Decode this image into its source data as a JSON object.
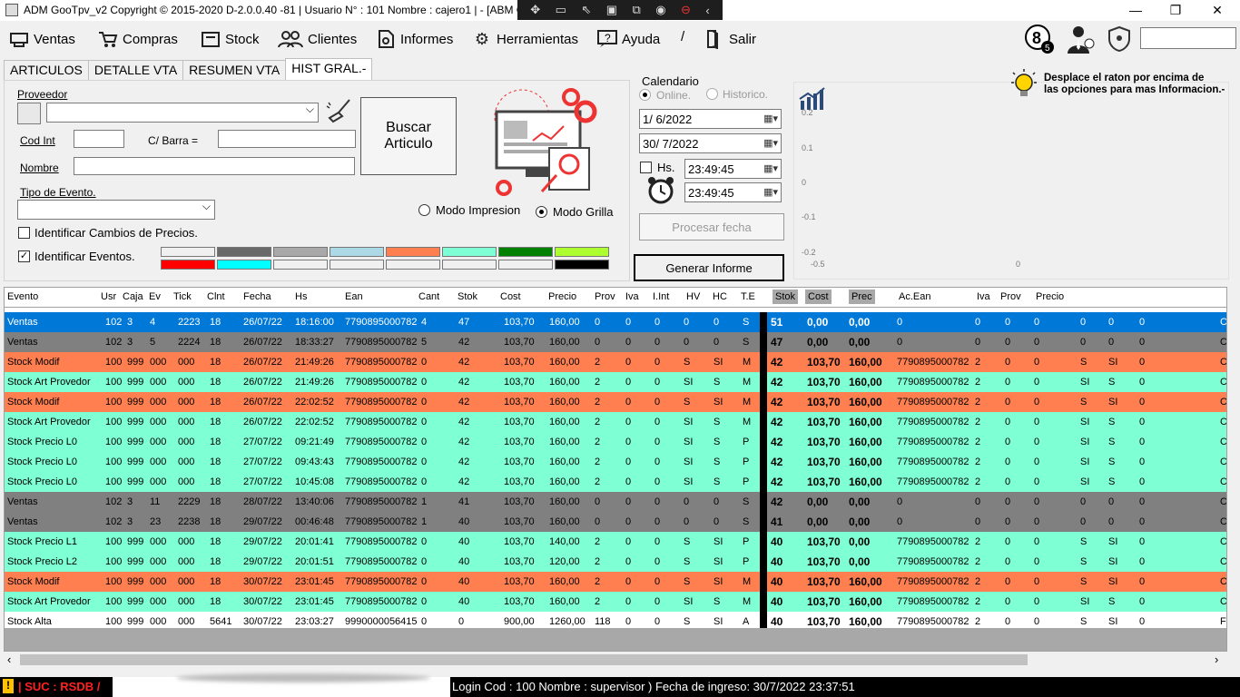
{
  "window": {
    "title": "ADM GooTpv_v2 Copyright ©  2015-2020 D-2.0.0.40 -81 | Usuario N° : 101 Nombre : cajero1 | - [ABM Ger",
    "minimize": "—",
    "restore": "❐",
    "close": "✕"
  },
  "menu": {
    "items": [
      {
        "label": "Ventas",
        "icon": "cart-register-icon"
      },
      {
        "label": "Compras",
        "icon": "shopping-cart-icon"
      },
      {
        "label": "Stock",
        "icon": "box-icon"
      },
      {
        "label": "Clientes",
        "icon": "users-icon"
      },
      {
        "label": "Informes",
        "icon": "report-icon"
      },
      {
        "label": "Herramientas",
        "icon": "gear-icon"
      },
      {
        "label": "Ayuda",
        "icon": "help-icon"
      },
      {
        "label": "/",
        "icon": ""
      },
      {
        "label": "Salir",
        "icon": "exit-icon"
      }
    ],
    "badge_count": "8",
    "badge_sub": "5"
  },
  "tabs": [
    "ARTICULOS",
    "DETALLE VTA",
    "RESUMEN VTA",
    "HIST GRAL.-"
  ],
  "form": {
    "proveedor_label": "Proveedor",
    "codint_label": "Cod Int",
    "cbarra_label": "C/ Barra =",
    "nombre_label": "Nombre",
    "tipo_evento_label": "Tipo de Evento.",
    "identificar_cambios_label": "Identificar Cambios de Precios.",
    "identificar_eventos_label": "Identificar Eventos.",
    "buscar_label_1": "Buscar",
    "buscar_label_2": "Articulo",
    "modo_impresion": "Modo Impresion",
    "modo_grilla": "Modo Grilla",
    "swatch_colors_top": [
      "#f0f0f0",
      "#696969",
      "#a9a9a9",
      "#add8e6",
      "#ff7f50",
      "#7fffd4",
      "#008000",
      "#adff2f"
    ],
    "swatch_colors_bottom": [
      "#ff0000",
      "#00ffff",
      "#f0f0f0",
      "#f0f0f0",
      "#f0f0f0",
      "#f0f0f0",
      "#f0f0f0",
      "#000000"
    ]
  },
  "calendar": {
    "title": "Calendario",
    "online": "Online.",
    "historico": "Historico.",
    "date_from": "1/  6/2022",
    "date_to": "30/  7/2022",
    "hs_label": "Hs.",
    "time_from": "23:49:45",
    "time_to": "23:49:45",
    "procesar_label": "Procesar fecha",
    "generar_label": "Generar Informe"
  },
  "chart_data": {
    "type": "line",
    "y_ticks": [
      "0.2",
      "0.1",
      "0",
      "-0.1",
      "-0.2"
    ],
    "x_ticks": [
      "-0.5",
      "0"
    ],
    "ylim": [
      -0.2,
      0.2
    ],
    "series": []
  },
  "tip": {
    "line1": "Desplace el raton por encima de",
    "line2": "las opciones para mas Informacion.-"
  },
  "grid": {
    "headers": [
      "Evento",
      "Usr",
      "Caja",
      "Ev",
      "Tick",
      "Clnt",
      "Fecha",
      "Hs",
      "Ean",
      "Cant",
      "Stok",
      "Cost",
      "Precio",
      "Prov",
      "Iva",
      "I.Int",
      "HV",
      "HC",
      "T.E",
      "Stok",
      "Cost",
      "Prec",
      "Ac.Ean",
      "Iva",
      "Prov",
      "Precio"
    ],
    "rows": [
      {
        "c": [
          "Ventas",
          "102",
          "3",
          "4",
          "2223",
          "18",
          "26/07/22",
          "18:16:00",
          "7790895000782",
          "4",
          "47",
          "103,70",
          "160,00",
          "0",
          "0",
          "0",
          "0",
          "0",
          "S",
          "51",
          "0,00",
          "0,00",
          "0",
          "0",
          "0",
          "0",
          "0",
          "0",
          "0",
          "C"
        ],
        "bg": "#0078d7",
        "fg": "#ffffff"
      },
      {
        "c": [
          "Ventas",
          "102",
          "3",
          "5",
          "2224",
          "18",
          "26/07/22",
          "18:33:27",
          "7790895000782",
          "5",
          "42",
          "103,70",
          "160,00",
          "0",
          "0",
          "0",
          "0",
          "0",
          "S",
          "47",
          "0,00",
          "0,00",
          "0",
          "0",
          "0",
          "0",
          "0",
          "0",
          "0",
          "C"
        ],
        "bg": "#808080",
        "fg": "#000000"
      },
      {
        "c": [
          "Stock Modif",
          "100",
          "999",
          "000",
          "000",
          "18",
          "26/07/22",
          "21:49:26",
          "7790895000782",
          "0",
          "42",
          "103,70",
          "160,00",
          "2",
          "0",
          "0",
          "S",
          "SI",
          "M",
          "42",
          "103,70",
          "160,00",
          "7790895000782",
          "2",
          "0",
          "0",
          "S",
          "SI",
          "0",
          "C"
        ],
        "bg": "#ff7f50",
        "fg": "#000000"
      },
      {
        "c": [
          "Stock Art Provedor",
          "100",
          "999",
          "000",
          "000",
          "18",
          "26/07/22",
          "21:49:26",
          "7790895000782",
          "0",
          "42",
          "103,70",
          "160,00",
          "2",
          "0",
          "0",
          "SI",
          "S",
          "M",
          "42",
          "103,70",
          "160,00",
          "7790895000782",
          "2",
          "0",
          "0",
          "SI",
          "S",
          "0",
          "C"
        ],
        "bg": "#7fffd4",
        "fg": "#000000"
      },
      {
        "c": [
          "Stock Modif",
          "100",
          "999",
          "000",
          "000",
          "18",
          "26/07/22",
          "22:02:52",
          "7790895000782",
          "0",
          "42",
          "103,70",
          "160,00",
          "2",
          "0",
          "0",
          "S",
          "SI",
          "M",
          "42",
          "103,70",
          "160,00",
          "7790895000782",
          "2",
          "0",
          "0",
          "S",
          "SI",
          "0",
          "C"
        ],
        "bg": "#ff7f50",
        "fg": "#000000"
      },
      {
        "c": [
          "Stock Art Provedor",
          "100",
          "999",
          "000",
          "000",
          "18",
          "26/07/22",
          "22:02:52",
          "7790895000782",
          "0",
          "42",
          "103,70",
          "160,00",
          "2",
          "0",
          "0",
          "SI",
          "S",
          "M",
          "42",
          "103,70",
          "160,00",
          "7790895000782",
          "2",
          "0",
          "0",
          "SI",
          "S",
          "0",
          "C"
        ],
        "bg": "#7fffd4",
        "fg": "#000000"
      },
      {
        "c": [
          "Stock Precio L0",
          "100",
          "999",
          "000",
          "000",
          "18",
          "27/07/22",
          "09:21:49",
          "7790895000782",
          "0",
          "42",
          "103,70",
          "160,00",
          "2",
          "0",
          "0",
          "SI",
          "S",
          "P",
          "42",
          "103,70",
          "160,00",
          "7790895000782",
          "2",
          "0",
          "0",
          "SI",
          "S",
          "0",
          "C"
        ],
        "bg": "#7fffd4",
        "fg": "#000000"
      },
      {
        "c": [
          "Stock Precio L0",
          "100",
          "999",
          "000",
          "000",
          "18",
          "27/07/22",
          "09:43:43",
          "7790895000782",
          "0",
          "42",
          "103,70",
          "160,00",
          "2",
          "0",
          "0",
          "SI",
          "S",
          "P",
          "42",
          "103,70",
          "160,00",
          "7790895000782",
          "2",
          "0",
          "0",
          "SI",
          "S",
          "0",
          "C"
        ],
        "bg": "#7fffd4",
        "fg": "#000000"
      },
      {
        "c": [
          "Stock Precio L0",
          "100",
          "999",
          "000",
          "000",
          "18",
          "27/07/22",
          "10:45:08",
          "7790895000782",
          "0",
          "42",
          "103,70",
          "160,00",
          "2",
          "0",
          "0",
          "SI",
          "S",
          "P",
          "42",
          "103,70",
          "160,00",
          "7790895000782",
          "2",
          "0",
          "0",
          "SI",
          "S",
          "0",
          "C"
        ],
        "bg": "#7fffd4",
        "fg": "#000000"
      },
      {
        "c": [
          "Ventas",
          "102",
          "3",
          "11",
          "2229",
          "18",
          "28/07/22",
          "13:40:06",
          "7790895000782",
          "1",
          "41",
          "103,70",
          "160,00",
          "0",
          "0",
          "0",
          "0",
          "0",
          "S",
          "42",
          "0,00",
          "0,00",
          "0",
          "0",
          "0",
          "0",
          "0",
          "0",
          "0",
          "C"
        ],
        "bg": "#808080",
        "fg": "#000000"
      },
      {
        "c": [
          "Ventas",
          "102",
          "3",
          "23",
          "2238",
          "18",
          "29/07/22",
          "00:46:48",
          "7790895000782",
          "1",
          "40",
          "103,70",
          "160,00",
          "0",
          "0",
          "0",
          "0",
          "0",
          "S",
          "41",
          "0,00",
          "0,00",
          "0",
          "0",
          "0",
          "0",
          "0",
          "0",
          "0",
          "C"
        ],
        "bg": "#808080",
        "fg": "#000000"
      },
      {
        "c": [
          "Stock Precio L1",
          "100",
          "999",
          "000",
          "000",
          "18",
          "29/07/22",
          "20:01:41",
          "7790895000782",
          "0",
          "40",
          "103,70",
          "140,00",
          "2",
          "0",
          "0",
          "S",
          "SI",
          "P",
          "40",
          "103,70",
          "0,00",
          "7790895000782",
          "2",
          "0",
          "0",
          "S",
          "SI",
          "0",
          "C"
        ],
        "bg": "#7fffd4",
        "fg": "#000000"
      },
      {
        "c": [
          "Stock Precio L2",
          "100",
          "999",
          "000",
          "000",
          "18",
          "29/07/22",
          "20:01:51",
          "7790895000782",
          "0",
          "40",
          "103,70",
          "120,00",
          "2",
          "0",
          "0",
          "S",
          "SI",
          "P",
          "40",
          "103,70",
          "0,00",
          "7790895000782",
          "2",
          "0",
          "0",
          "S",
          "SI",
          "0",
          "C"
        ],
        "bg": "#7fffd4",
        "fg": "#000000"
      },
      {
        "c": [
          "Stock Modif",
          "100",
          "999",
          "000",
          "000",
          "18",
          "30/07/22",
          "23:01:45",
          "7790895000782",
          "0",
          "40",
          "103,70",
          "160,00",
          "2",
          "0",
          "0",
          "S",
          "SI",
          "M",
          "40",
          "103,70",
          "160,00",
          "7790895000782",
          "2",
          "0",
          "0",
          "S",
          "SI",
          "0",
          "C"
        ],
        "bg": "#ff7f50",
        "fg": "#000000"
      },
      {
        "c": [
          "Stock Art Provedor",
          "100",
          "999",
          "000",
          "000",
          "18",
          "30/07/22",
          "23:01:45",
          "7790895000782",
          "0",
          "40",
          "103,70",
          "160,00",
          "2",
          "0",
          "0",
          "SI",
          "S",
          "M",
          "40",
          "103,70",
          "160,00",
          "7790895000782",
          "2",
          "0",
          "0",
          "SI",
          "S",
          "0",
          "C"
        ],
        "bg": "#7fffd4",
        "fg": "#000000"
      },
      {
        "c": [
          "Stock Alta",
          "100",
          "999",
          "000",
          "000",
          "5641",
          "30/07/22",
          "23:03:27",
          "9990000056415",
          "0",
          "0",
          "900,00",
          "1260,00",
          "118",
          "0",
          "0",
          "S",
          "SI",
          "A",
          "40",
          "103,70",
          "160,00",
          "7790895000782",
          "2",
          "0",
          "0",
          "S",
          "SI",
          "0",
          "F"
        ],
        "bg": "#ffffff",
        "fg": "#000000"
      }
    ]
  },
  "status": {
    "left": "| SUC : RSDB /",
    "right": "Login Cod : 100 Nombre : supervisor ) Fecha de ingreso: 30/7/2022 23:37:51"
  }
}
